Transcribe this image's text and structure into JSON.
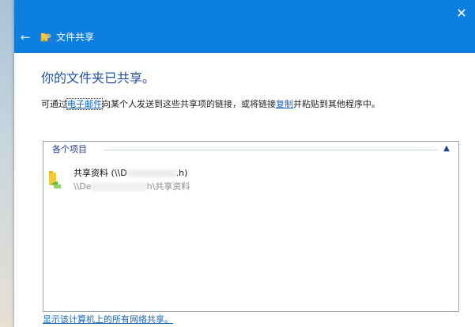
{
  "window": {
    "title": "文件共享",
    "close_glyph": "✕",
    "back_glyph": "←"
  },
  "main": {
    "heading": "你的文件夹已共享。",
    "description": {
      "part1": "可通过",
      "email_link": "电子邮件",
      "part2": "向某个人发送到这些共享项的链接，或将链接",
      "copy_link": "复制",
      "part3": "并粘贴到其他程序中。"
    },
    "group": {
      "label": "各个项目",
      "collapse_glyph": "▲"
    },
    "items": [
      {
        "name_prefix": "共享资料 (\\\\D",
        "name_suffix": ".h)",
        "path_prefix": "\\\\De",
        "path_suffix": "h\\共享资料",
        "icon": "shared-folder-icon"
      }
    ]
  },
  "footer": {
    "link": "显示该计算机上的所有网络共享。"
  },
  "colors": {
    "titlebar": "#0d7fe0",
    "heading": "#1f4f9e",
    "link": "#1565c0"
  }
}
